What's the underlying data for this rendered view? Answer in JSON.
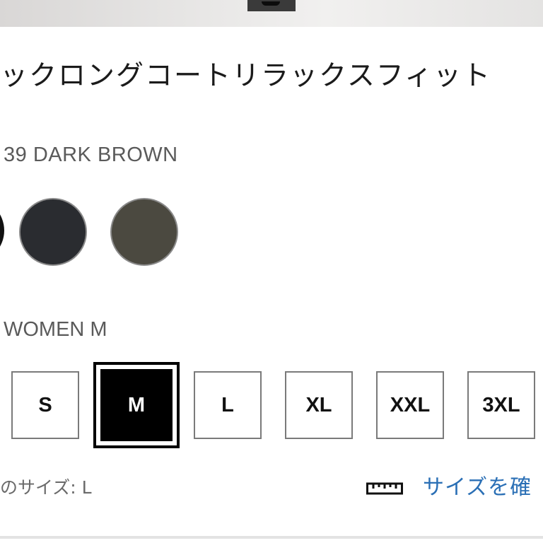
{
  "product": {
    "title": "ックロングコートリラックスフィット"
  },
  "color": {
    "selected_label": "39 DARK BROWN",
    "swatches": [
      {
        "name": "partial-left",
        "hex": "#ffffff"
      },
      {
        "name": "navy",
        "hex": "#2a2c30"
      },
      {
        "name": "olive",
        "hex": "#4b4940"
      }
    ]
  },
  "size": {
    "selected_label": "WOMEN M",
    "options": [
      "S",
      "M",
      "L",
      "XL",
      "XXL",
      "3XL"
    ],
    "selected": "M",
    "fit_hint": "のサイズ: L",
    "size_guide_link": "サイズを確"
  },
  "colors": {
    "accent_link": "#2a6fb5",
    "selected_bg": "#000000"
  }
}
